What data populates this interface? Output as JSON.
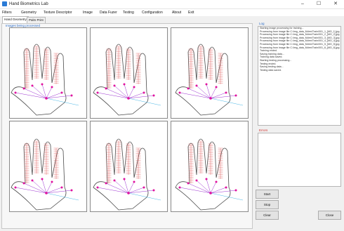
{
  "window": {
    "title": "Hand Biometrics Lab",
    "minimize": "–",
    "maximize": "☐",
    "close": "✕"
  },
  "menu": [
    "Filters",
    "Geometry",
    "Texture Descriptor",
    "Image",
    "Data Fuzer",
    "Testing",
    "Configuration",
    "About",
    "Exit"
  ],
  "tabs": [
    {
      "label": "Hand Geometry",
      "active": true
    },
    {
      "label": "Palm Print",
      "active": false
    }
  ],
  "main": {
    "caption": "Images being processed"
  },
  "log": {
    "label": "Log",
    "lines": [
      "Starting image processing for training...",
      "Processing from image file C:\\img_data_Mdrm\\Train\\001_1_[MO_1].jpg",
      "Processing from image file C:\\img_data_Mdrm\\Train\\001_2_[MO_2].jpg",
      "Processing from image file C:\\img_data_Mdrm\\Train\\001_3_[MO_3].jpg",
      "Processing from image file C:\\img_data_Mdrm\\Train\\001_4_[MO_4].jpg",
      "Processing from image file C:\\img_data_Mdrm\\Train\\001_5_[MO_5].jpg",
      "Processing from image file C:\\img_data_Mdrm\\Train\\001_6_[MO_6].jpg",
      "Training ended.",
      "Saving training data...",
      "Training data saved.",
      "Starting testing processing...",
      "Testing ended.",
      "Saving testing data...",
      "Testing data saved."
    ]
  },
  "errors": {
    "label": "Errors"
  },
  "buttons": {
    "start": "Start",
    "stop": "Stop",
    "clear": "Clear",
    "close": "Close"
  },
  "colors": {
    "accent": "#2d6ec9",
    "error_label": "#d0312d",
    "landmark": "#e0119e",
    "geometry_lines": "#9b2fd0",
    "finger_lines": "#e05555"
  }
}
